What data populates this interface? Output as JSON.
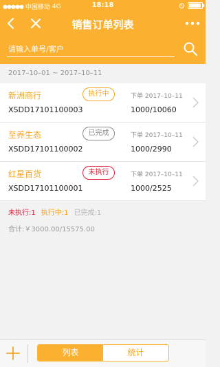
{
  "status_bar": {
    "carrier": "中国移动",
    "network": "4G",
    "time": "18:18",
    "battery_level": 0.92
  },
  "nav": {
    "title": "销售订单列表",
    "back_icon": "chevron-left-icon",
    "close_icon": "close-icon",
    "more_icon": "more-dots-icon"
  },
  "search": {
    "placeholder": "请输入单号/客户",
    "value": "",
    "icon": "search-icon"
  },
  "date_range": "2017–10–01 ~ 2017–10–11",
  "orders": [
    {
      "customer": "新洲商行",
      "order_no": "XSDD17101100003",
      "status": "执行中",
      "date": "下单 2017–10–11",
      "qty": "1000/10060"
    },
    {
      "customer": "至养生态",
      "order_no": "XSDD17101100002",
      "status": "已完成",
      "date": "下单 2017–10–11",
      "qty": "1000/2990"
    },
    {
      "customer": "红星百货",
      "order_no": "XSDD17101100001",
      "status": "未执行",
      "date": "下单 2017–10–11",
      "qty": "1000/2525"
    }
  ],
  "summary": {
    "pending": "未执行:1",
    "in_progress": "执行中:1",
    "completed": "已完成:1",
    "total": "合计:￥3000.00/15575.00"
  },
  "bottom": {
    "tab_list": "列表",
    "tab_stats": "统计",
    "add_icon": "plus-icon"
  },
  "colors": {
    "accent": "#fbb12f",
    "pending": "#e0203b",
    "in_progress": "#f5a623",
    "completed": "#8a8a8a"
  }
}
